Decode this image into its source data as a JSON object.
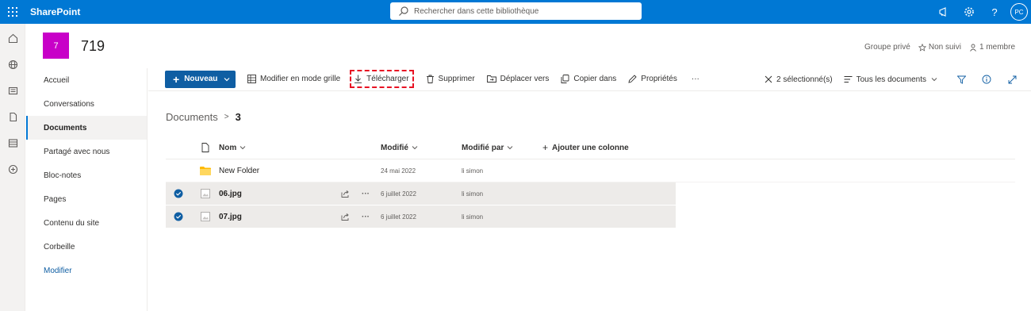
{
  "app": {
    "brand": "SharePoint"
  },
  "search": {
    "placeholder": "Rechercher dans cette bibliothèque"
  },
  "account": {
    "initials": "PC"
  },
  "site": {
    "logo_letter": "7",
    "title": "719",
    "privacy": "Groupe privé",
    "follow": "Non suivi",
    "members": "1 membre"
  },
  "nav": {
    "items": [
      {
        "label": "Accueil"
      },
      {
        "label": "Conversations"
      },
      {
        "label": "Documents"
      },
      {
        "label": "Partagé avec nous"
      },
      {
        "label": "Bloc-notes"
      },
      {
        "label": "Pages"
      },
      {
        "label": "Contenu du site"
      },
      {
        "label": "Corbeille"
      }
    ],
    "edit": "Modifier"
  },
  "commands": {
    "new": "Nouveau",
    "grid": "Modifier en mode grille",
    "download": "Télécharger",
    "delete": "Supprimer",
    "move": "Déplacer vers",
    "copy": "Copier dans",
    "properties": "Propriétés",
    "more": "···",
    "selected": "2 sélectionné(s)",
    "view": "Tous les documents"
  },
  "breadcrumb": {
    "root": "Documents",
    "current": "3"
  },
  "table": {
    "columns": {
      "name": "Nom",
      "modified": "Modifié",
      "modified_by": "Modifié par",
      "add": "Ajouter une colonne"
    },
    "rows": [
      {
        "name": "New Folder",
        "modified": "24 mai 2022",
        "by": "li simon"
      },
      {
        "name": "06.jpg",
        "modified": "6 juillet 2022",
        "by": "li simon"
      },
      {
        "name": "07.jpg",
        "modified": "6 juillet 2022",
        "by": "li simon"
      }
    ]
  },
  "colors": {
    "brand": "#0078d4",
    "site_logo": "#c800c8",
    "new_button": "#0f5ea3",
    "highlight": "#e81123"
  }
}
